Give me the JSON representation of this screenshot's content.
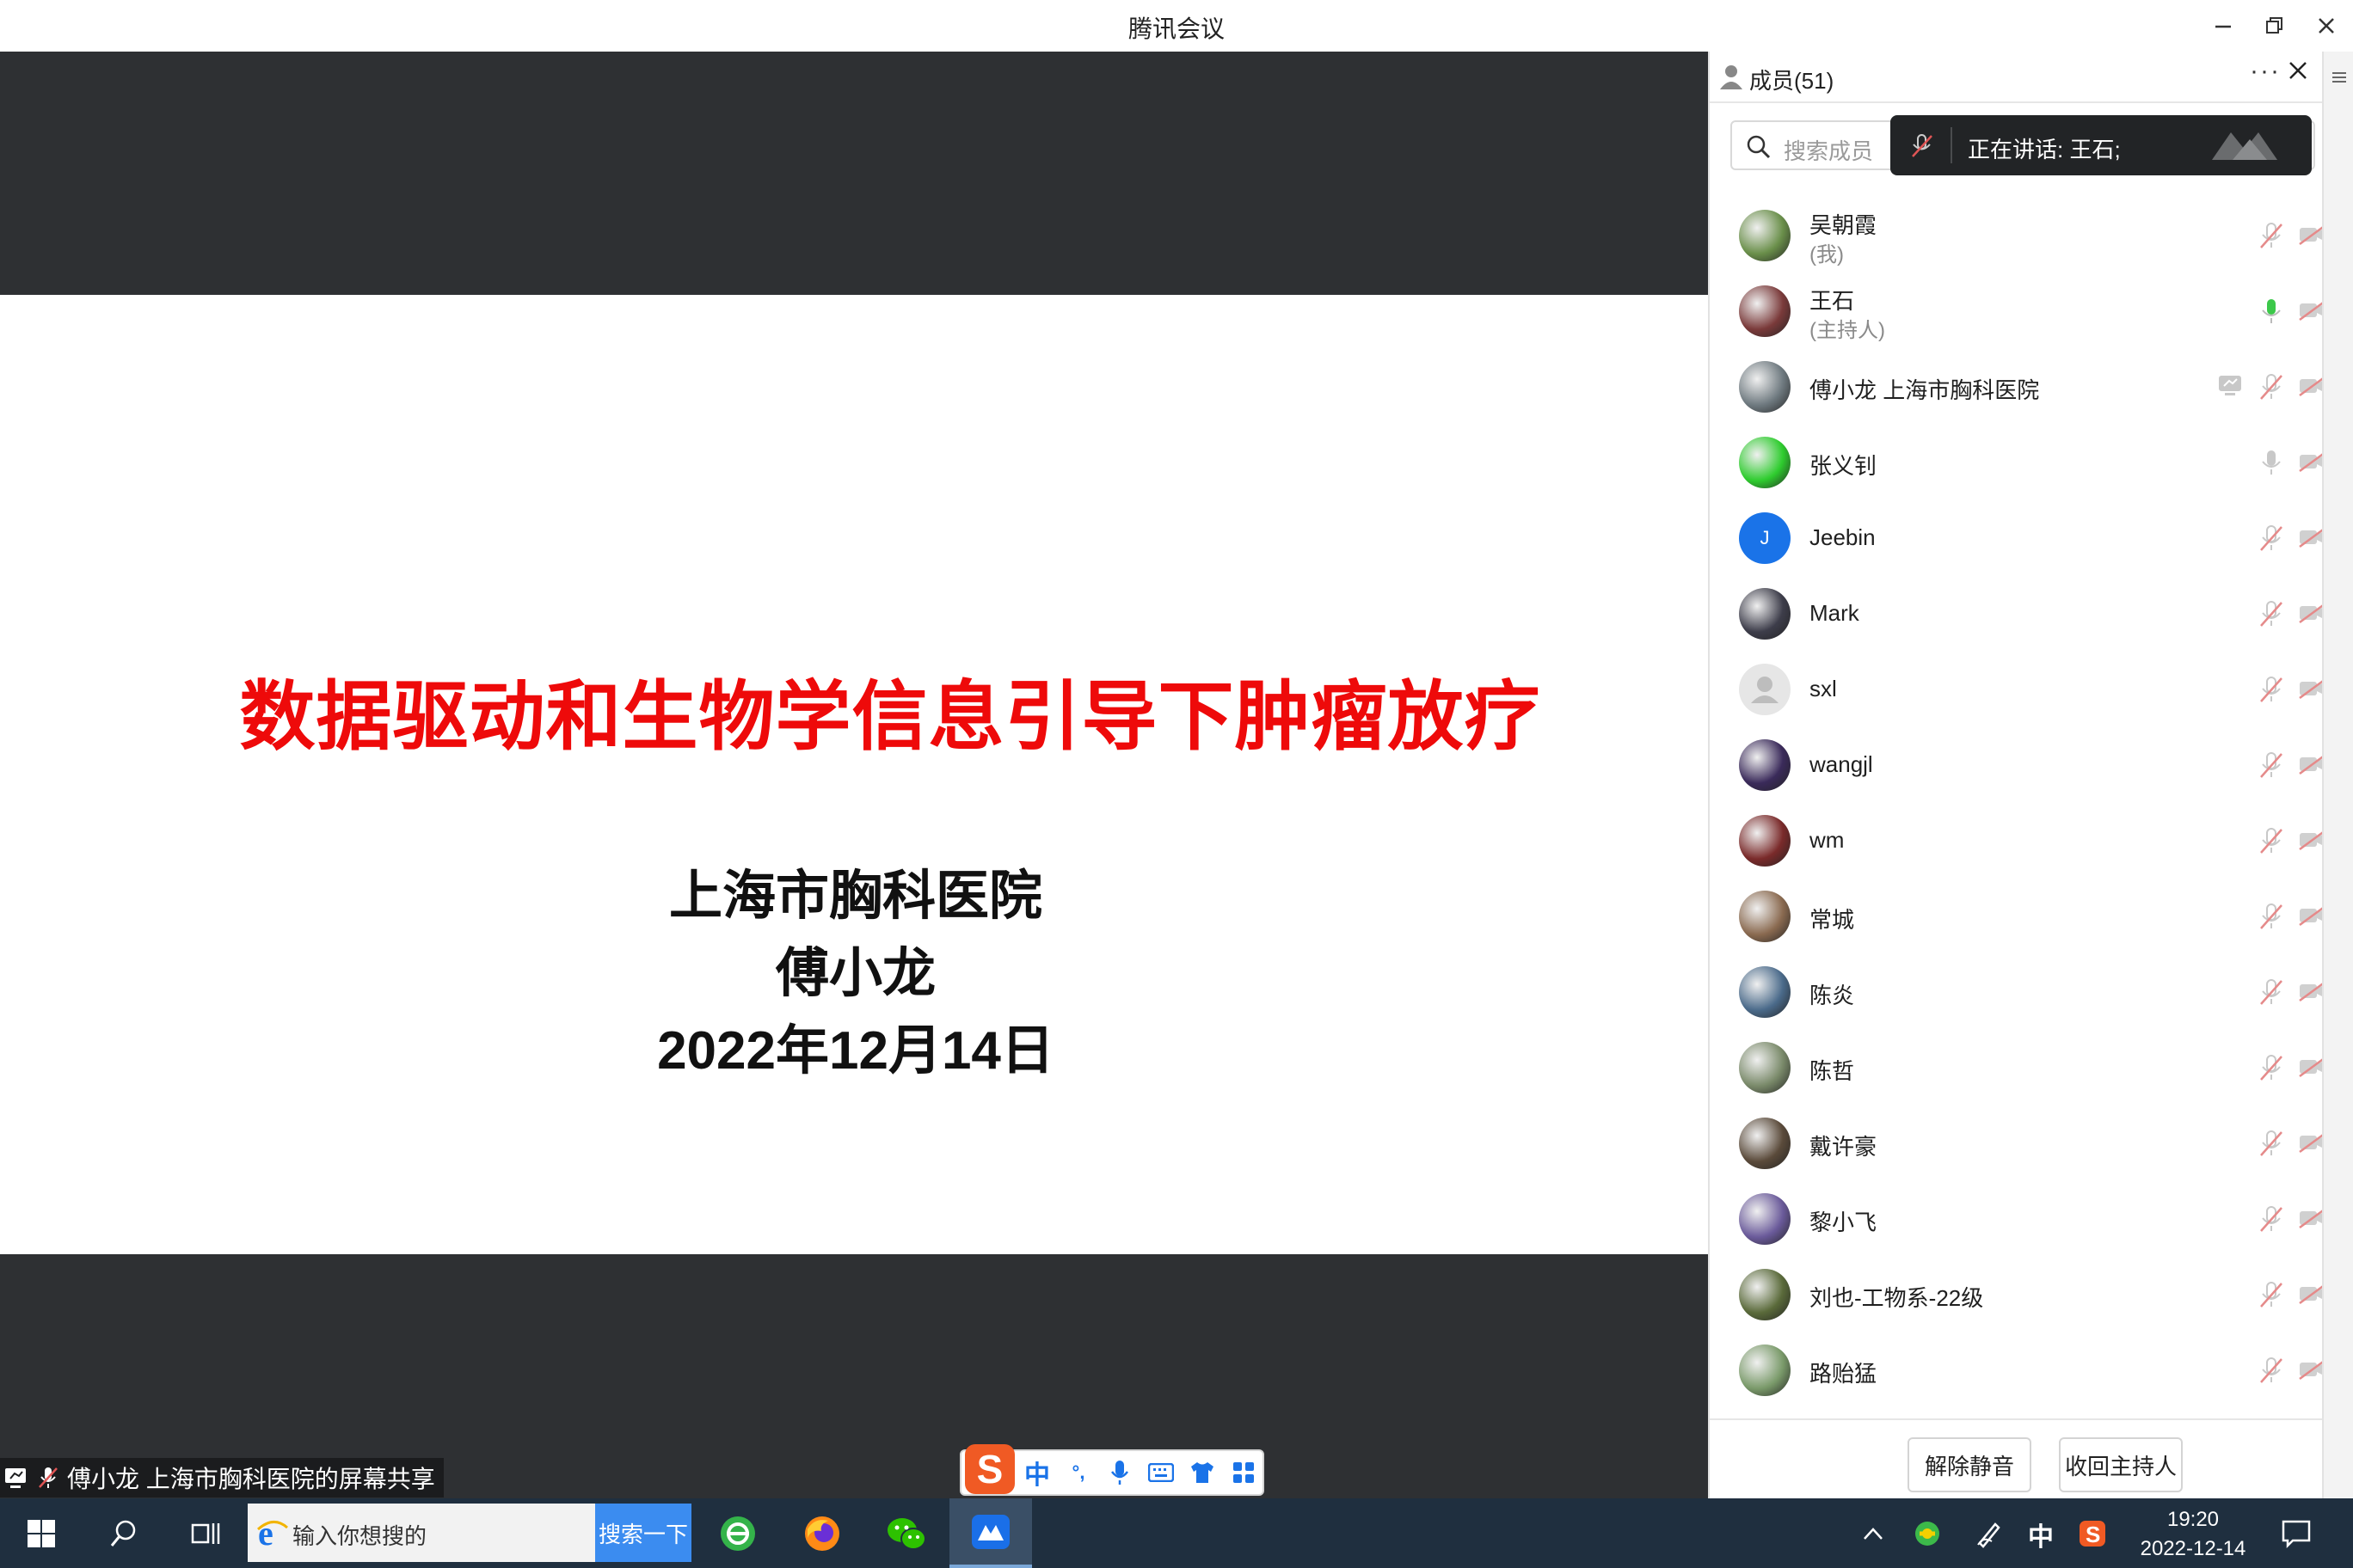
{
  "window": {
    "title": "腾讯会议"
  },
  "slide": {
    "title": "数据驱动和生物学信息引导下肿瘤放疗",
    "organization": "上海市胸科医院",
    "author": "傅小龙",
    "date": "2022年12月14日"
  },
  "share_caption": "傅小龙 上海市胸科医院的屏幕共享",
  "members_panel": {
    "title": "成员(51)",
    "search_placeholder": "搜索成员",
    "speaking_text": "正在讲话: 王石;",
    "members": [
      {
        "name": "吴朝霞",
        "role": "(我)",
        "mic": "muted",
        "video": "off",
        "avatar": "photo"
      },
      {
        "name": "王石",
        "role": "(主持人)",
        "mic": "active",
        "video": "off",
        "avatar": "photo"
      },
      {
        "name": "傅小龙 上海市胸科医院",
        "role": "",
        "mic": "muted",
        "video": "off",
        "sharing": true,
        "avatar": "photo"
      },
      {
        "name": "张义钊",
        "role": "",
        "mic": "unmuted",
        "video": "off",
        "avatar": "photo"
      },
      {
        "name": "Jeebin",
        "role": "",
        "mic": "muted",
        "video": "off",
        "avatar": "letter",
        "initial": "J"
      },
      {
        "name": "Mark",
        "role": "",
        "mic": "muted",
        "video": "off",
        "avatar": "photo"
      },
      {
        "name": "sxl",
        "role": "",
        "mic": "muted",
        "video": "off",
        "avatar": "default"
      },
      {
        "name": "wangjl",
        "role": "",
        "mic": "muted",
        "video": "off",
        "avatar": "photo"
      },
      {
        "name": "wm",
        "role": "",
        "mic": "muted",
        "video": "off",
        "avatar": "photo"
      },
      {
        "name": "常城",
        "role": "",
        "mic": "muted",
        "video": "off",
        "avatar": "photo"
      },
      {
        "name": "陈炎",
        "role": "",
        "mic": "muted",
        "video": "off",
        "avatar": "photo"
      },
      {
        "name": "陈哲",
        "role": "",
        "mic": "muted",
        "video": "off",
        "avatar": "photo"
      },
      {
        "name": "戴许豪",
        "role": "",
        "mic": "muted",
        "video": "off",
        "avatar": "photo"
      },
      {
        "name": "黎小飞",
        "role": "",
        "mic": "muted",
        "video": "off",
        "avatar": "photo"
      },
      {
        "name": "刘也-工物系-22级",
        "role": "",
        "mic": "muted",
        "video": "off",
        "avatar": "photo"
      },
      {
        "name": "路贻猛",
        "role": "",
        "mic": "muted",
        "video": "off",
        "avatar": "photo"
      }
    ],
    "unmute_all_label": "解除静音",
    "reclaim_host_label": "收回主持人"
  },
  "taskbar": {
    "search_placeholder": "输入你想搜的",
    "search_button": "搜索一下",
    "ime_indicator": "中",
    "time": "19:20",
    "date": "2022-12-14"
  },
  "ime_toolbar": {
    "mode": "中",
    "punct": "°,"
  },
  "colors": {
    "slide_title": "#ee0a0a",
    "share_background": "#2e3033",
    "taskbar": "#1f2f3f",
    "mic_active": "#3cc84a",
    "muted_red": "#e05555",
    "ime_logo": "#f05a24"
  }
}
